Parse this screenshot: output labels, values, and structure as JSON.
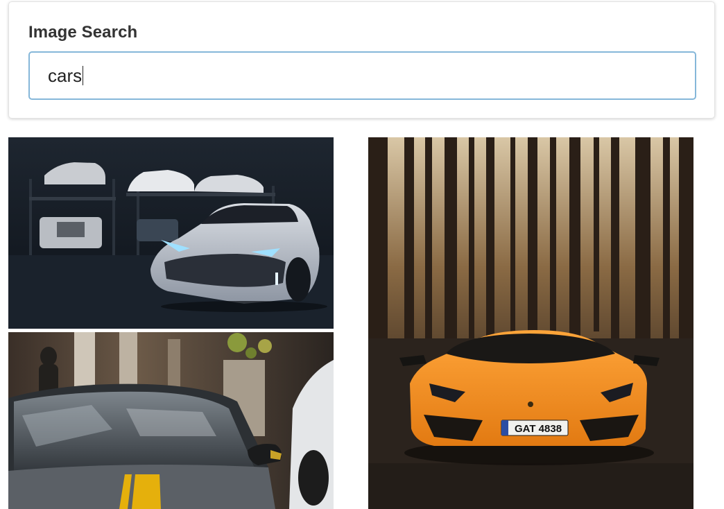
{
  "search": {
    "label": "Image Search",
    "value": "cars"
  },
  "results": [
    {
      "subject": "white sports car in dark garage"
    },
    {
      "subject": "grey car with yellow stripe"
    },
    {
      "subject": "orange supercar in forest",
      "plate": "GAT 4838"
    }
  ],
  "colors": {
    "input_border": "#85b7d9",
    "label_text": "#333333"
  }
}
